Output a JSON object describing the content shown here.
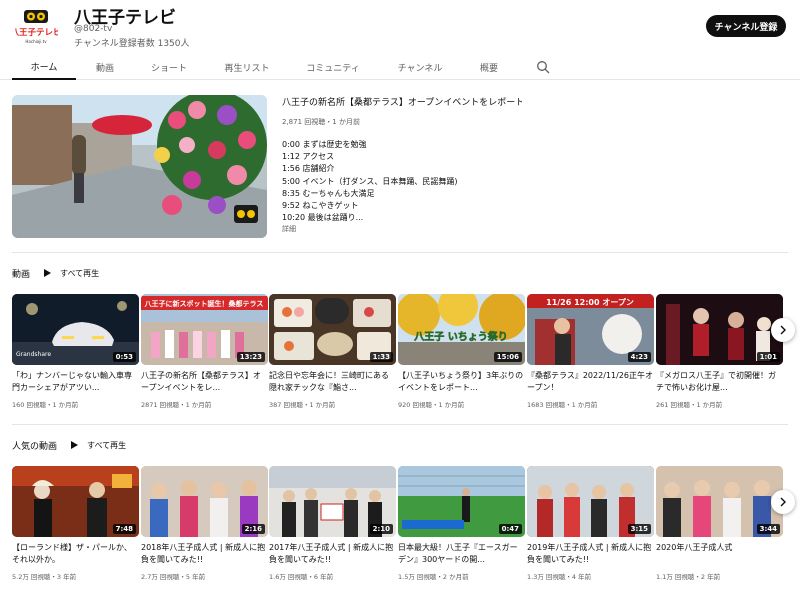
{
  "channel": {
    "logo_text": "八王子テレビ",
    "logo_subtext": "Hachioji.tv",
    "name": "八王子テレビ",
    "handle": "@802-tv",
    "subscribers": "チャンネル登録者数 1350人",
    "subscribe_label": "チャンネル登録"
  },
  "tabs": [
    "ホーム",
    "動画",
    "ショート",
    "再生リスト",
    "コミュニティ",
    "チャンネル",
    "概要"
  ],
  "featured": {
    "title": "八王子の新名所【桑都テラス】オープンイベントをレポート...",
    "meta": "2,871 回視聴・1 か月前",
    "chapters": [
      "0:00 まずは歴史を勉強",
      "1:12 アクセス",
      "1:56 店舗紹介",
      "5:00 イベント（打ダンス、日本舞踊、民謡舞踊)",
      "8:35 むーちゃんも大満足",
      "9:52 ねこやきゲット",
      "10:20 最後は盆踊り..."
    ],
    "more_label": "詳細"
  },
  "shelf1": {
    "title": "動画",
    "playall": "すべて再生",
    "videos": [
      {
        "duration": "0:53",
        "title": "「わ」ナンバーじゃない輸入車専門カーシェアがアツい...",
        "meta": "160 回視聴・1 か月前",
        "overlay": "Grandshare"
      },
      {
        "duration": "13:23",
        "title": "八王子の新名所【桑都テラス】オープンイベントをレ...",
        "meta": "2871 回視聴・1 か月前",
        "overlay": "八王子に新スポット誕生！桑都テラス"
      },
      {
        "duration": "1:33",
        "title": "記念日や忘年会に！三崎町にある隠れ家チックな『鮨さ...",
        "meta": "387 回視聴・1 か月前",
        "overlay": ""
      },
      {
        "duration": "15:06",
        "title": "【八王子いちょう祭り】3年ぶりのイベントをレポート...",
        "meta": "920 回視聴・1 か月前",
        "overlay": "八王子 いちょう祭り"
      },
      {
        "duration": "4:23",
        "title": "『桑都テラス』2022/11/26正午オープン！",
        "meta": "1683 回視聴・1 か月前",
        "overlay": "11/26 12:00 オープン"
      },
      {
        "duration": "1:01",
        "title": "『メガロス八王子』で初開催！ガチで怖いお化け屋...",
        "meta": "261 回視聴・1 か月前",
        "overlay": ""
      }
    ]
  },
  "shelf2": {
    "title": "人気の動画",
    "playall": "すべて再生",
    "videos": [
      {
        "duration": "7:48",
        "title": "【ローランド様】ザ・パールか、それ以外か。",
        "meta": "5.2万 回視聴・3 年前",
        "overlay": ""
      },
      {
        "duration": "2:16",
        "title": "2018年八王子成人式 | 新成人に抱負を聞いてみた!!",
        "meta": "2.7万 回視聴・5 年前",
        "overlay": ""
      },
      {
        "duration": "2:10",
        "title": "2017年八王子成人式 | 新成人に抱負を聞いてみた!!",
        "meta": "1.6万 回視聴・6 年前",
        "overlay": ""
      },
      {
        "duration": "0:47",
        "title": "日本最大級！八王子『エースガーデン』300ヤードの開...",
        "meta": "1.5万 回視聴・2 か月前",
        "overlay": ""
      },
      {
        "duration": "3:15",
        "title": "2019年八王子成人式 | 新成人に抱負を聞いてみた!!",
        "meta": "1.3万 回視聴・4 年前",
        "overlay": ""
      },
      {
        "duration": "3:44",
        "title": "2020年八王子成人式",
        "meta": "1.1万 回視聴・2 年前",
        "overlay": ""
      }
    ]
  },
  "icons": {
    "search": "search-icon",
    "next": "chevron-right-icon",
    "play": "play-icon"
  }
}
